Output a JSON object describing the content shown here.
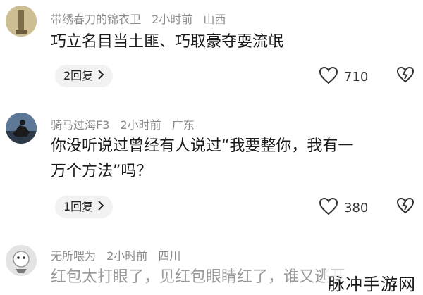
{
  "comments": [
    {
      "username": "带绣春刀的锦衣卫",
      "time": "2小时前",
      "location": "山西",
      "lines": [
        "巧立名目当土匪、巧取豪夺耍流氓"
      ],
      "reply_label": "2回复",
      "likes": "710"
    },
    {
      "username": "骑马过海F3",
      "time": "2小时前",
      "location": "广东",
      "lines": [
        "你没听说过曾经有人说过“我要整你，我有一",
        "万个方法”吗？"
      ],
      "reply_label": "1回复",
      "likes": "380"
    },
    {
      "username": "无所喂为",
      "time": "2小时前",
      "location": "四川",
      "lines": [
        "红包太打眼了，见红包眼睛红了，谁又逃开"
      ]
    }
  ],
  "watermark": "脉冲手游网",
  "icons": {
    "reply_arrow": "chevron-right-icon",
    "like": "heart-icon",
    "dislike": "broken-heart-icon"
  }
}
